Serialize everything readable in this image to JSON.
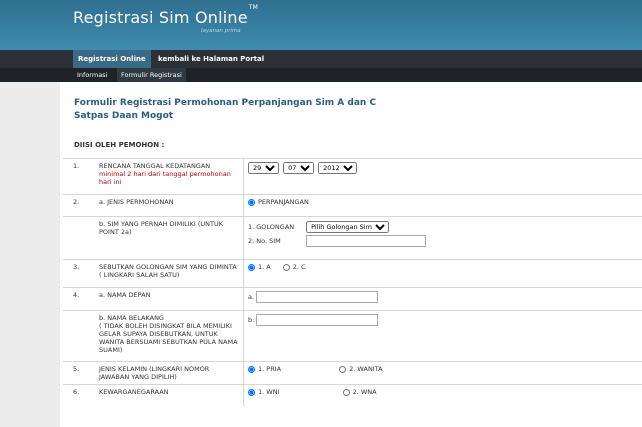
{
  "header": {
    "brand": "Registrasi Sim Online",
    "brand_mark": "TM",
    "tagline": "layanan prima"
  },
  "nav": {
    "primary": [
      "Registrasi Online",
      "kembali ke Halaman Portal"
    ],
    "secondary": [
      "Informasi",
      "Formulir Registrasi"
    ]
  },
  "form": {
    "title_line1": "Formulir Registrasi Permohonan Perpanjangan Sim A dan C",
    "title_line2": "Satpas Daan Mogot",
    "section_title": "DIISI OLEH PEMOHON :",
    "rows": {
      "r1": {
        "num": "1.",
        "label": "RENCANA TANGGAL KEDATANGAN",
        "note": "minimal 2 hari dari tanggal permohonan hari ini",
        "day": "29",
        "month": "07",
        "year": "2012"
      },
      "r2": {
        "num": "2.",
        "label_a": "a. JENIS PERMOHONAN",
        "option": "PERPANJANGAN",
        "label_b": "b. SIM YANG PERNAH DIMILIKI (UNTUK POINT 2a)",
        "golongan_label": "1. GOLONGAN",
        "golongan_value": "Pilih Golongan Sim",
        "nosim_label": "2. No. SIM",
        "nosim_value": ""
      },
      "r3": {
        "num": "3.",
        "label": "SEBUTKAN GOLONGAN SIM YANG DIMINTA ( LINGKARI SALAH SATU)",
        "opt1": "1. A",
        "opt2": "2. C"
      },
      "r4": {
        "num": "4.",
        "label_a": "a. NAMA DEPAN",
        "prefix_a": "a.",
        "label_b": "b. NAMA BELAKANG",
        "note_b": "( TIDAK BOLEH DISINGKAT BILA MEMILIKI GELAR SUPAYA DISEBUTKAN, UNTUK WANITA BERSUAMI SEBUTKAN PULA NAMA SUAMI)",
        "prefix_b": "b."
      },
      "r5": {
        "num": "5.",
        "label": "JENIS KELAMIN (LINGKARI NOMOR JAWABAN YANG DIPILIH)",
        "opt1": "1. PRIA",
        "opt2": "2. WANITA"
      },
      "r6": {
        "num": "6.",
        "label": "KEWARGANEGARAAN",
        "opt1": "1. WNI",
        "opt2": "2. WNA"
      }
    }
  }
}
